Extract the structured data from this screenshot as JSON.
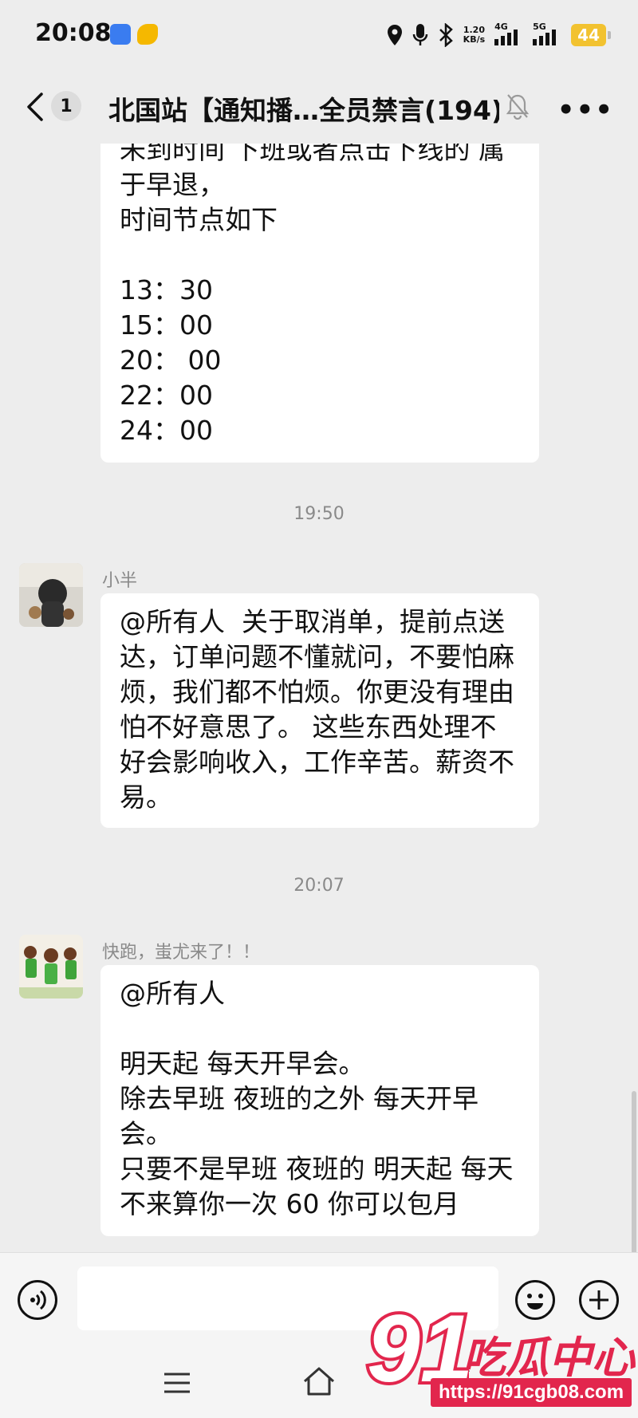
{
  "status_bar": {
    "time": "20:08",
    "network_speed": "1.20",
    "network_unit": "KB/s",
    "sim1_type": "4G",
    "sim2_type": "5G",
    "battery": "44",
    "icons": [
      "location-icon",
      "mic-icon",
      "bluetooth-icon",
      "signal-icon",
      "battery-icon"
    ]
  },
  "header": {
    "unread_count": "1",
    "title": "北国站【通知播…全员禁言(194)",
    "icons": [
      "back-icon",
      "mute-bell-icon",
      "more-icon"
    ]
  },
  "messages": [
    {
      "type": "text",
      "sender": "",
      "text": "未到时间 下班或者点击下线的 属\n于早退，\n时间节点如下\n\n13：30\n15：00\n20： 00\n22：00\n24：00"
    },
    {
      "type": "timestamp",
      "text": "19:50"
    },
    {
      "type": "text",
      "sender": "小半",
      "text": "@所有人  关于取消单，提前点送\n达，订单问题不懂就问，不要怕麻\n烦，我们都不怕烦。你更没有理由\n怕不好意思了。 这些东西处理不\n好会影响收入，工作辛苦。薪资不\n易。"
    },
    {
      "type": "timestamp",
      "text": "20:07"
    },
    {
      "type": "text",
      "sender": "快跑，蚩尤来了！！",
      "text": "@所有人\n\n明天起 每天开早会。\n除去早班 夜班的之外 每天开早\n会。\n只要不是早班 夜班的 明天起 每天\n不来算你一次 60 你可以包月"
    }
  ],
  "input_bar": {
    "placeholder": "",
    "icons": [
      "voice-icon",
      "emoji-icon",
      "plus-icon"
    ]
  },
  "watermark": {
    "logo_number": "91",
    "name": "吃瓜中心",
    "url": "https://91cgb08.com"
  },
  "colors": {
    "background": "#ededed",
    "bubble": "#ffffff",
    "battery": "#f2c230",
    "watermark": "#e2264d"
  }
}
